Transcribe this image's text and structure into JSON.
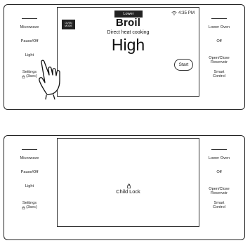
{
  "panel_top": {
    "left_buttons": [
      {
        "label": "Microwave"
      },
      {
        "label": "Pause/Off"
      },
      {
        "label": "Light"
      },
      {
        "label": "Settings\n⚿(3sec)",
        "line1": "Settings",
        "line2": "(3sec)"
      }
    ],
    "right_buttons": [
      {
        "label": "Lower Oven"
      },
      {
        "label": "Off"
      },
      {
        "label": "Open/Close Reservoir",
        "line1": "Open/Close",
        "line2": "Reservoir"
      },
      {
        "label": "Smart Control",
        "line1": "Smart",
        "line2": "Control"
      }
    ],
    "display": {
      "oven_badge": "Lower",
      "oven_mode_tag_line1": "OVEN",
      "oven_mode_tag_line2": "MODE",
      "time": "4:35 PM",
      "mode_title": "Broil",
      "mode_subtitle": "Direct heat cooking",
      "setting_value": "High",
      "start_label": "Start"
    }
  },
  "panel_bottom": {
    "left_buttons": [
      {
        "label": "Microwave"
      },
      {
        "label": "Pause/Off"
      },
      {
        "label": "Light"
      },
      {
        "label": "Settings (3sec)",
        "line1": "Settings",
        "line2": "(3sec)"
      }
    ],
    "right_buttons": [
      {
        "label": "Lower Oven"
      },
      {
        "label": "Off"
      },
      {
        "label": "Open/Close Reservoir",
        "line1": "Open/Close",
        "line2": "Reservoir"
      },
      {
        "label": "Smart Control",
        "line1": "Smart",
        "line2": "Control"
      }
    ],
    "display": {
      "lock_message": "Child Lock"
    }
  },
  "icons": {
    "wifi": "wifi-icon",
    "lock": "lock-icon",
    "hand_pointer": "hand-pointer-icon"
  }
}
